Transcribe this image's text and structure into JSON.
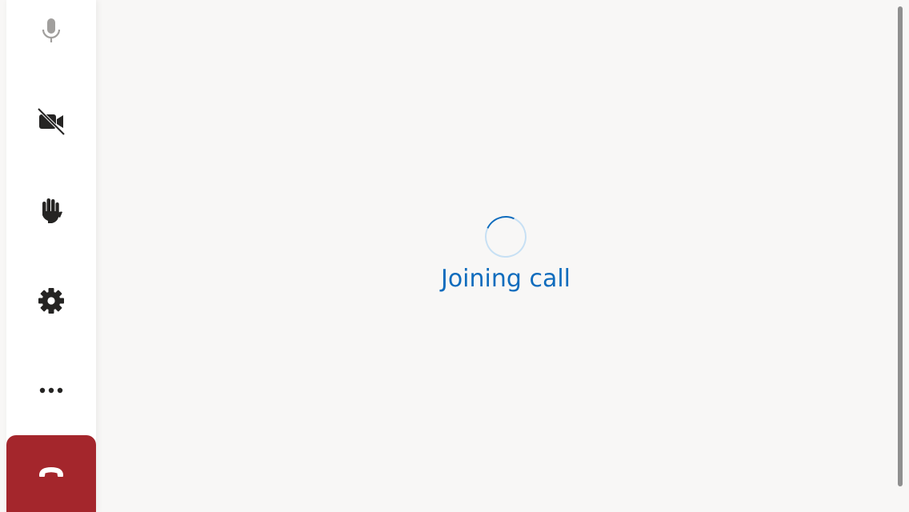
{
  "colors": {
    "accent": "#0f6cbd",
    "hangup": "#a4262c",
    "icon": "#252423",
    "icon_muted": "#a19f9d",
    "stage_background": "#f8f7f6",
    "rail_background": "#ffffff"
  },
  "controls": {
    "microphone": {
      "icon": "microphone-icon",
      "state": "muted"
    },
    "camera": {
      "icon": "video-off-icon",
      "state": "off"
    },
    "raise_hand": {
      "icon": "hand-icon"
    },
    "settings": {
      "icon": "gear-icon"
    },
    "more": {
      "icon": "more-horizontal-icon"
    },
    "hangup": {
      "icon": "phone-hangup-icon"
    }
  },
  "status": {
    "spinner": "loading-spinner",
    "label": "Joining call"
  }
}
